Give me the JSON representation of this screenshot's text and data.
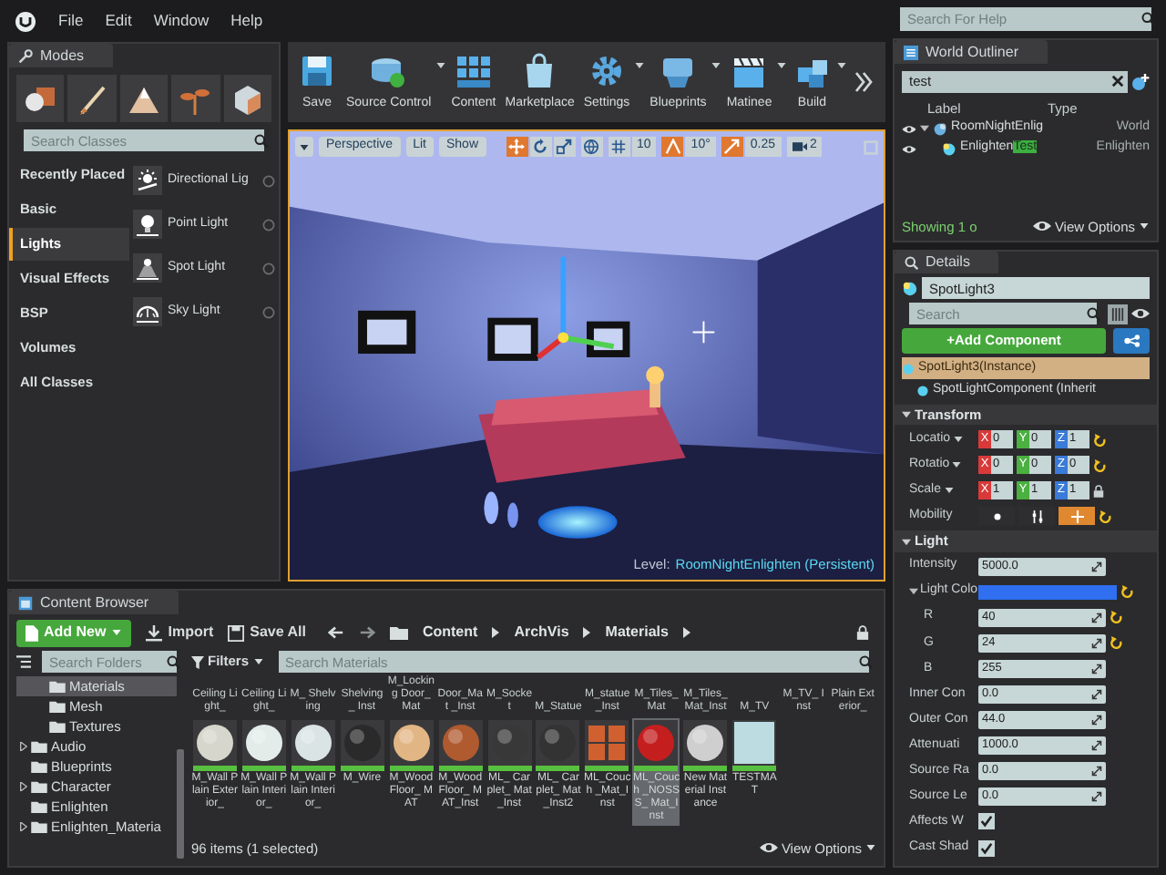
{
  "menu": [
    "File",
    "Edit",
    "Window",
    "Help"
  ],
  "help_search": {
    "placeholder": "Search For Help"
  },
  "modes": {
    "title": "Modes",
    "search": {
      "placeholder": "Search Classes"
    },
    "categories": [
      {
        "label": "Recently Placed",
        "selected": false
      },
      {
        "label": "Basic",
        "selected": false
      },
      {
        "label": "Lights",
        "selected": true
      },
      {
        "label": "Visual Effects",
        "selected": false
      },
      {
        "label": "BSP",
        "selected": false
      },
      {
        "label": "Volumes",
        "selected": false
      },
      {
        "label": "All Classes",
        "selected": false
      }
    ],
    "items": [
      {
        "label": "Directional Lig",
        "kind": "directional"
      },
      {
        "label": "Point Light",
        "kind": "point"
      },
      {
        "label": "Spot Light",
        "kind": "spot"
      },
      {
        "label": "Sky Light",
        "kind": "sky"
      }
    ]
  },
  "toolbar": [
    {
      "label": "Save",
      "kind": "save",
      "dropdown": false
    },
    {
      "label": "Source Control",
      "kind": "source_control",
      "dropdown": true
    },
    {
      "label": "Content",
      "kind": "content",
      "dropdown": false
    },
    {
      "label": "Marketplace",
      "kind": "marketplace",
      "dropdown": false
    },
    {
      "label": "Settings",
      "kind": "settings",
      "dropdown": true
    },
    {
      "label": "Blueprints",
      "kind": "blueprints",
      "dropdown": true
    },
    {
      "label": "Matinee",
      "kind": "matinee",
      "dropdown": true
    },
    {
      "label": "Build",
      "kind": "build",
      "dropdown": true
    }
  ],
  "viewport": {
    "view_buttons": [
      "Perspective",
      "Lit",
      "Show"
    ],
    "transform_tools": [
      {
        "kind": "move",
        "selected": true
      },
      {
        "kind": "rotate",
        "selected": false
      },
      {
        "kind": "scale",
        "selected": false
      }
    ],
    "snaps": [
      {
        "kind": "grid",
        "value": "10",
        "on": false
      },
      {
        "kind": "angle",
        "value": "10°",
        "on": true
      },
      {
        "kind": "scale",
        "value": "0.25",
        "on": true
      }
    ],
    "camera_speed": "2",
    "level_label": "Level:",
    "level_name": "RoomNightEnlighten (Persistent)"
  },
  "world_outliner": {
    "title": "World Outliner",
    "search": {
      "value": "test"
    },
    "columns": [
      "Label",
      "Type"
    ],
    "rows": [
      {
        "label": "RoomNightEnlig",
        "type": "World",
        "expanded": true,
        "children": [
          {
            "label": "Enlighten",
            "match": "Test",
            "type": "Enlighten"
          }
        ]
      }
    ],
    "summary": "Showing 1 o",
    "view_options": "View Options"
  },
  "details": {
    "title": "Details",
    "object_name": "SpotLight3",
    "search": {
      "placeholder": "Search"
    },
    "add_component": "+Add Component",
    "components": [
      {
        "label": "SpotLight3(Instance)",
        "selected": true
      },
      {
        "label": "SpotLightComponent (Inherit",
        "selected": false
      }
    ],
    "sections": [
      {
        "title": "Transform",
        "expanded": true,
        "rows": [
          {
            "kind": "vector",
            "label": "Locatio",
            "axes": [
              "X",
              "Y",
              "Z"
            ],
            "values": [
              "0",
              "0",
              "1"
            ],
            "modified": true
          },
          {
            "kind": "vector",
            "label": "Rotatio",
            "axes": [
              "X",
              "Y",
              "Z"
            ],
            "values": [
              "0",
              "0",
              "0"
            ],
            "modified": true
          },
          {
            "kind": "vector",
            "label": "Scale",
            "axes": [
              "X",
              "Y",
              "Z"
            ],
            "values": [
              "1",
              "1",
              "1"
            ],
            "modified": false,
            "locked": true
          },
          {
            "kind": "mobility",
            "label": "Mobility",
            "options": [
              {
                "selected": false
              },
              {
                "selected": false
              },
              {
                "selected": true
              }
            ],
            "modified": true
          }
        ]
      },
      {
        "title": "Light",
        "expanded": true,
        "rows": [
          {
            "kind": "number",
            "label": "Intensity",
            "value": "5000.0",
            "modified": false
          },
          {
            "kind": "color",
            "label": "Light Colo",
            "color": "#2f6ff0",
            "modified": true,
            "expanded": true,
            "children": [
              {
                "kind": "number",
                "label": "R",
                "value": "40",
                "modified": true
              },
              {
                "kind": "number",
                "label": "G",
                "value": "24",
                "modified": true
              },
              {
                "kind": "number",
                "label": "B",
                "value": "255",
                "modified": false
              }
            ]
          },
          {
            "kind": "number",
            "label": "Inner Con",
            "value": "0.0",
            "modified": false
          },
          {
            "kind": "number",
            "label": "Outer Con",
            "value": "44.0",
            "modified": false
          },
          {
            "kind": "number",
            "label": "Attenuati",
            "value": "1000.0",
            "modified": false
          },
          {
            "kind": "number",
            "label": "Source Ra",
            "value": "0.0",
            "modified": false
          },
          {
            "kind": "number",
            "label": "Source Le",
            "value": "0.0",
            "modified": false
          },
          {
            "kind": "checkbox",
            "label": "Affects W",
            "checked": true
          },
          {
            "kind": "checkbox",
            "label": "Cast Shad",
            "checked": true
          }
        ]
      }
    ]
  },
  "content_browser": {
    "title": "Content Browser",
    "add_new": "Add New",
    "buttons": [
      "Import",
      "Save All"
    ],
    "path": [
      "Content",
      "ArchVis",
      "Materials"
    ],
    "folder_search": {
      "placeholder": "Search Folders"
    },
    "nested_folders": [
      {
        "label": "Materials",
        "selected": true
      },
      {
        "label": "Mesh",
        "selected": false
      },
      {
        "label": "Textures",
        "selected": false
      }
    ],
    "folders": [
      {
        "label": "Audio",
        "expandable": true,
        "selected": false
      },
      {
        "label": "Blueprints",
        "expandable": false,
        "selected": false
      },
      {
        "label": "Character",
        "expandable": true,
        "selected": false
      },
      {
        "label": "Enlighten",
        "expandable": false,
        "selected": false
      },
      {
        "label": "Enlighten_Materia",
        "expandable": true,
        "selected": false
      }
    ],
    "filters": "Filters",
    "asset_search": {
      "placeholder": "Search Materials"
    },
    "clipped_assets": [
      "Ceiling Light_",
      "Ceiling Light_",
      "M_ Shelving",
      "Shelving_ Inst",
      "M_Locking Door_Mat",
      "Door_Mat _Inst",
      "M_Socket",
      "M_Statue",
      "M_statue _Inst",
      "M_Tiles_ Mat",
      "M_Tiles_ Mat_Inst",
      "M_TV",
      "M_TV_ Inst",
      "Plain Exterior_"
    ],
    "assets": [
      {
        "label": "M_Wall Plain Exterior_",
        "kind": "sphere",
        "color": "#d6d6cc",
        "selected": false
      },
      {
        "label": "M_Wall Plain Interior_",
        "kind": "sphere",
        "color": "#e4ecea",
        "selected": false
      },
      {
        "label": "M_Wall Plain Interior_",
        "kind": "sphere",
        "color": "#dbe4e4",
        "selected": false
      },
      {
        "label": "M_Wire",
        "kind": "sphere",
        "color": "#2a2a2a",
        "selected": false
      },
      {
        "label": "M_Wood Floor_ MAT",
        "kind": "sphere",
        "color": "#e2b684",
        "selected": false
      },
      {
        "label": "M_Wood Floor_ MAT_Inst",
        "kind": "sphere",
        "color": "#b05a30",
        "selected": false
      },
      {
        "label": "ML_ Carplet_ Mat_Inst",
        "kind": "sphere",
        "color": "#383838",
        "selected": false
      },
      {
        "label": "ML_ Carplet_ Mat_Inst2",
        "kind": "sphere",
        "color": "#333333",
        "selected": false
      },
      {
        "label": "ML_Couch _Mat_Inst",
        "kind": "boxes",
        "color": "#d06030",
        "selected": false
      },
      {
        "label": "ML_Couch _NOSSS_ Mat_Inst",
        "kind": "sphere",
        "color": "#c41e1e",
        "selected": true
      },
      {
        "label": "New Material Instance",
        "kind": "sphere",
        "color": "#cfcfcf",
        "selected": false
      },
      {
        "label": "TESTMAT",
        "kind": "plane",
        "color": "#bcdce2",
        "selected": false
      }
    ],
    "summary": "96 items (1 selected)",
    "view_options": "View Options"
  }
}
